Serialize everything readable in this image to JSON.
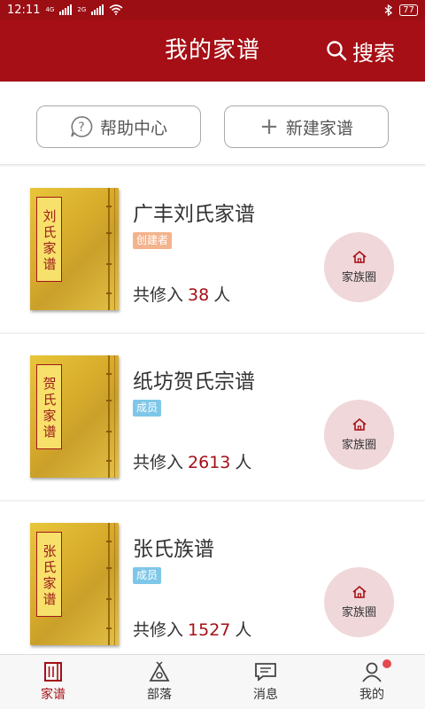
{
  "status_bar": {
    "time": "12:11",
    "net1": "4G",
    "net2": "2G",
    "bluetooth_icon": "bluetooth-icon",
    "battery": "77"
  },
  "header": {
    "title": "我的家谱",
    "search_label": "搜索",
    "search_icon": "search-icon"
  },
  "actions": {
    "help_label": "帮助中心",
    "new_label": "新建家谱"
  },
  "families": [
    {
      "book_label": "刘氏家谱",
      "name": "广丰刘氏家谱",
      "role": "创建者",
      "count_prefix": "共修入",
      "count": "38",
      "count_suffix": "人",
      "circle_label": "家族圈"
    },
    {
      "book_label": "贺氏家谱",
      "name": "纸坊贺氏宗谱",
      "role": "成员",
      "count_prefix": "共修入",
      "count": "2613",
      "count_suffix": "人",
      "circle_label": "家族圈"
    },
    {
      "book_label": "张氏家谱",
      "name": "张氏族谱",
      "role": "成员",
      "count_prefix": "共修入",
      "count": "1527",
      "count_suffix": "人",
      "circle_label": "家族圈"
    }
  ],
  "tabs": [
    {
      "label": "家谱",
      "icon": "book-icon",
      "active": true
    },
    {
      "label": "部落",
      "icon": "tribe-icon",
      "active": false
    },
    {
      "label": "消息",
      "icon": "message-icon",
      "active": false
    },
    {
      "label": "我的",
      "icon": "user-icon",
      "active": false,
      "badge_dot": true
    }
  ],
  "colors": {
    "brand": "#a50f15",
    "creator_badge": "#f3b38d",
    "member_badge": "#7fc7e8",
    "circle_bg": "#f0d7da"
  }
}
